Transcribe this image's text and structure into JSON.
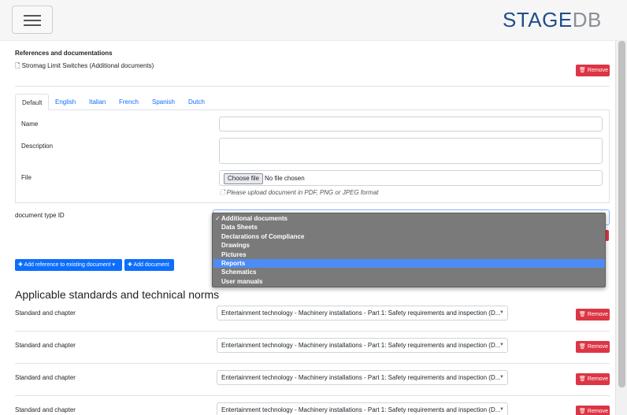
{
  "header": {
    "brand_part1": "STAGE",
    "brand_part2": "DB",
    "menu_icon": "hamburger-icon"
  },
  "references": {
    "title": "References and documentations",
    "document_label": "Stromag Limit Switches (Additional documents)",
    "remove_label": "Remove"
  },
  "tabs": [
    "Default",
    "English",
    "Italian",
    "French",
    "Spanish",
    "Dutch"
  ],
  "form": {
    "name_label": "Name",
    "name_value": "",
    "description_label": "Description",
    "description_value": "",
    "file_label": "File",
    "file_button": "Choose file",
    "file_status": "No file chosen",
    "file_hint": "Please upload document in PDF, PNG or JPEG format",
    "doc_type_label": "document type ID"
  },
  "dropdown": {
    "checked": "Additional documents",
    "options": [
      "Additional documents",
      "Data Sheets",
      "Declarations of Compliance",
      "Drawings",
      "Pictures",
      "Reports",
      "Schematics",
      "User manuals"
    ],
    "highlighted": "Reports"
  },
  "actions": {
    "add_reference": "Add reference to existing document",
    "add_document": "Add document"
  },
  "standards": {
    "heading": "Applicable standards and technical norms",
    "rows": [
      {
        "label": "Standard and chapter",
        "value": "Entertainment technology - Machinery installations - Part 1: Safety requirements and inspection (D...",
        "remove": "Remove"
      },
      {
        "label": "Standard and chapter",
        "value": "Entertainment technology - Machinery installations - Part 1: Safety requirements and inspection (D...",
        "remove": "Remove"
      },
      {
        "label": "Standard and chapter",
        "value": "Entertainment technology - Machinery installations - Part 1: Safety requirements and inspection (D...",
        "remove": "Remove"
      },
      {
        "label": "Standard and chapter",
        "value": "Entertainment technology - Machinery installations - Part 1: Safety requirements and inspection (D...",
        "remove": "Remove"
      }
    ]
  },
  "colors": {
    "brand_blue": "#1f4e8a",
    "brand_gray": "#8b8f96",
    "danger": "#dc3545",
    "primary": "#0d6efd",
    "highlight": "#4e8cf5"
  }
}
